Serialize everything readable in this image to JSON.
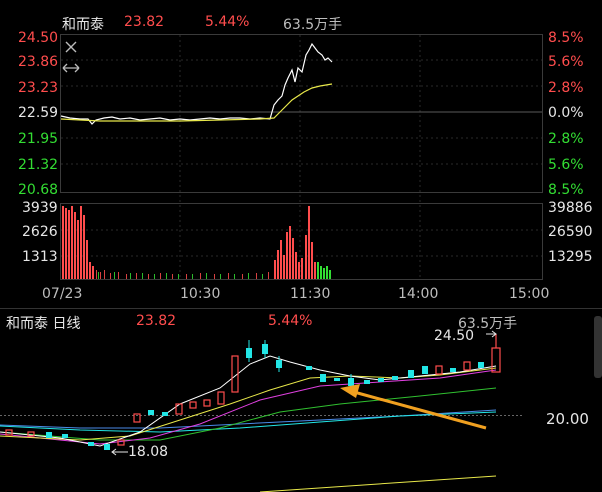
{
  "intraday": {
    "stock_name": "和而泰",
    "price": "23.82",
    "change_pct": "5.44%",
    "volume": "63.5万手",
    "price_axis": [
      "24.50",
      "23.86",
      "23.23",
      "22.59",
      "21.95",
      "21.32",
      "20.68"
    ],
    "pct_axis": [
      "8.5%",
      "5.6%",
      "2.8%",
      "0.0%",
      "2.8%",
      "5.6%",
      "8.5%"
    ],
    "vol_axis_left": [
      "3939",
      "2626",
      "1313"
    ],
    "vol_axis_right": [
      "39886",
      "26590",
      "13295"
    ],
    "time_axis": [
      "07/23",
      "10:30",
      "11:30",
      "14:00",
      "15:00"
    ],
    "close_icon": "close-icon",
    "expand_icon": "expand-horizontal-icon"
  },
  "kline": {
    "title": "和而泰 日线",
    "price": "23.82",
    "change_pct": "5.44%",
    "volume": "63.5万手",
    "high_marker": "24.50",
    "low_marker": "18.08",
    "axis_price": "20.00",
    "arrow_color": "#f0a020"
  },
  "colors": {
    "up": "#ff4d4d",
    "down": "#33dd33",
    "cyan": "#22e6e6",
    "yellow": "#e8e84a",
    "white_line": "#ffffff",
    "magenta": "#e040e0",
    "ma_green": "#30c030",
    "ma_blue": "#4a8ae8"
  }
}
